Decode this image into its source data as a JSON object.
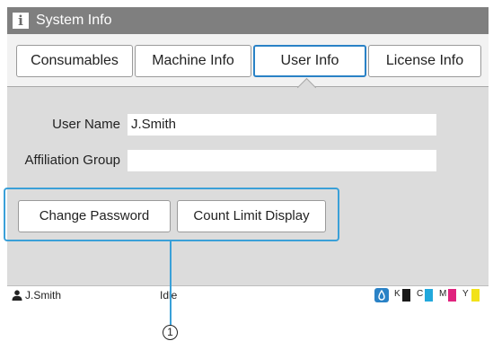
{
  "window": {
    "title": "System Info"
  },
  "tabs": [
    {
      "label": "Consumables",
      "active": false
    },
    {
      "label": "Machine Info",
      "active": false
    },
    {
      "label": "User Info",
      "active": true
    },
    {
      "label": "License Info",
      "active": false
    }
  ],
  "form": {
    "user_name_label": "User Name",
    "user_name_value": "J.Smith",
    "affiliation_label": "Affiliation Group",
    "affiliation_value": ""
  },
  "buttons": {
    "change_password": "Change Password",
    "count_limit_display": "Count Limit Display"
  },
  "status_bar": {
    "user": "J.Smith",
    "status": "Idle",
    "inks": [
      {
        "label": "K",
        "color": "#1a1a1a"
      },
      {
        "label": "C",
        "color": "#22a8dc"
      },
      {
        "label": "M",
        "color": "#e0237e"
      },
      {
        "label": "Y",
        "color": "#f2e21a"
      }
    ],
    "ink_icon_color": "#2a82c6"
  },
  "callout": {
    "number": "1"
  },
  "colors": {
    "accent": "#2a82c6",
    "highlight": "#3aa0d8",
    "titlebar": "#7f7f7f"
  }
}
